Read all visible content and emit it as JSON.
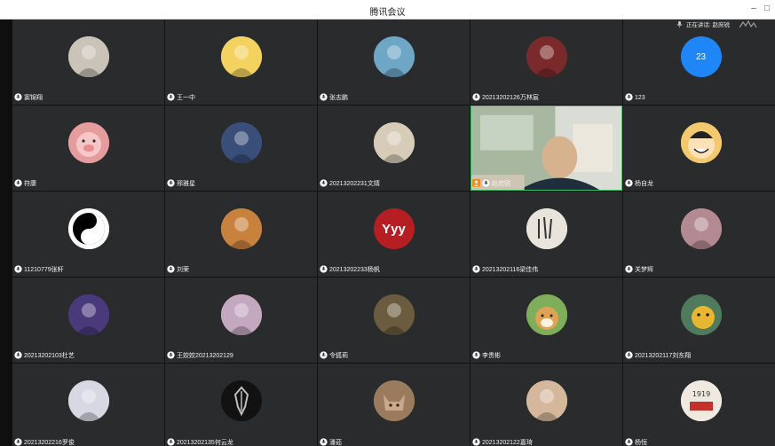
{
  "window": {
    "title": "腾讯会议",
    "minimize": "–",
    "maximize": "□"
  },
  "speaking": {
    "label": "正在讲话: 赵庶锐"
  },
  "tiles": [
    {
      "name": "窦锦翔",
      "avatar": {
        "kind": "photo",
        "icon": "two-people-photo",
        "bg": "#c9c3b8"
      }
    },
    {
      "name": "王一中",
      "avatar": {
        "kind": "cartoon",
        "icon": "crayon-shin-chan",
        "bg": "#f3d25f"
      }
    },
    {
      "name": "张志鹏",
      "avatar": {
        "kind": "art",
        "icon": "anime-character",
        "bg": "#6ea6c6"
      }
    },
    {
      "name": "20213202126万林宸",
      "avatar": {
        "kind": "art",
        "icon": "anime-girl",
        "bg": "#7a2a2a"
      }
    },
    {
      "name": "123",
      "avatar": {
        "kind": "text",
        "text": "23",
        "bg": "#1f86f7"
      }
    },
    {
      "name": "符康",
      "avatar": {
        "kind": "cartoon",
        "icon": "pig-cartoon",
        "bg": "#e59c9c"
      }
    },
    {
      "name": "邢雅星",
      "avatar": {
        "kind": "art",
        "icon": "anime-boy",
        "bg": "#3a4e7a"
      }
    },
    {
      "name": "20213202231文婧",
      "avatar": {
        "kind": "art",
        "icon": "vintage-portrait",
        "bg": "#d7ccb8"
      }
    },
    {
      "name": "赵庶锐",
      "avatar": {
        "kind": "video",
        "icon": "webcam-video"
      }
    },
    {
      "name": "杨自龙",
      "avatar": {
        "kind": "cartoon",
        "icon": "luffy-cartoon",
        "bg": "#f3c970"
      }
    },
    {
      "name": "11210779张轩",
      "avatar": {
        "kind": "symbol",
        "icon": "yin-yang-icon",
        "bg": "#ffffff"
      }
    },
    {
      "name": "刘荣",
      "avatar": {
        "kind": "art",
        "icon": "doll-girl",
        "bg": "#c9823e"
      }
    },
    {
      "name": "20213202233杨帆",
      "avatar": {
        "kind": "text",
        "text": "Yyy",
        "bg": "#b51e22"
      }
    },
    {
      "name": "20213202116梁佳伟",
      "avatar": {
        "kind": "art",
        "icon": "calligraphy-art",
        "bg": "#e8e4dc"
      }
    },
    {
      "name": "关梦辉",
      "avatar": {
        "kind": "art",
        "icon": "pink-girl",
        "bg": "#b48a92"
      }
    },
    {
      "name": "20213202103杜艺",
      "avatar": {
        "kind": "art",
        "icon": "neon-figure",
        "bg": "#4a3a7c"
      }
    },
    {
      "name": "王姣姣20213202129",
      "avatar": {
        "kind": "photo",
        "icon": "sunset-sky",
        "bg": "#c3a8c0"
      }
    },
    {
      "name": "令狐莉",
      "avatar": {
        "kind": "art",
        "icon": "vintage-lady",
        "bg": "#6b5b3f"
      }
    },
    {
      "name": "李贵彬",
      "avatar": {
        "kind": "photo",
        "icon": "shiba-dog",
        "bg": "#7fae5a"
      }
    },
    {
      "name": "20213202117刘东翔",
      "avatar": {
        "kind": "cartoon",
        "icon": "yellow-cat",
        "bg": "#4f7a5c"
      }
    },
    {
      "name": "20213202216罗俊",
      "avatar": {
        "kind": "art",
        "icon": "anime-boy-white",
        "bg": "#d8d8e4"
      }
    },
    {
      "name": "20213202135何云龙",
      "avatar": {
        "kind": "symbol",
        "icon": "dragon-emblem",
        "bg": "#121212"
      }
    },
    {
      "name": "潘茹",
      "avatar": {
        "kind": "photo",
        "icon": "cat-photo",
        "bg": "#9a7b5e"
      }
    },
    {
      "name": "20213202122嘉琦",
      "avatar": {
        "kind": "art",
        "icon": "anime-face",
        "bg": "#d5b79c"
      }
    },
    {
      "name": "杨恒",
      "avatar": {
        "kind": "art",
        "icon": "new-youth-poster",
        "bg": "#efe9e0"
      }
    }
  ]
}
